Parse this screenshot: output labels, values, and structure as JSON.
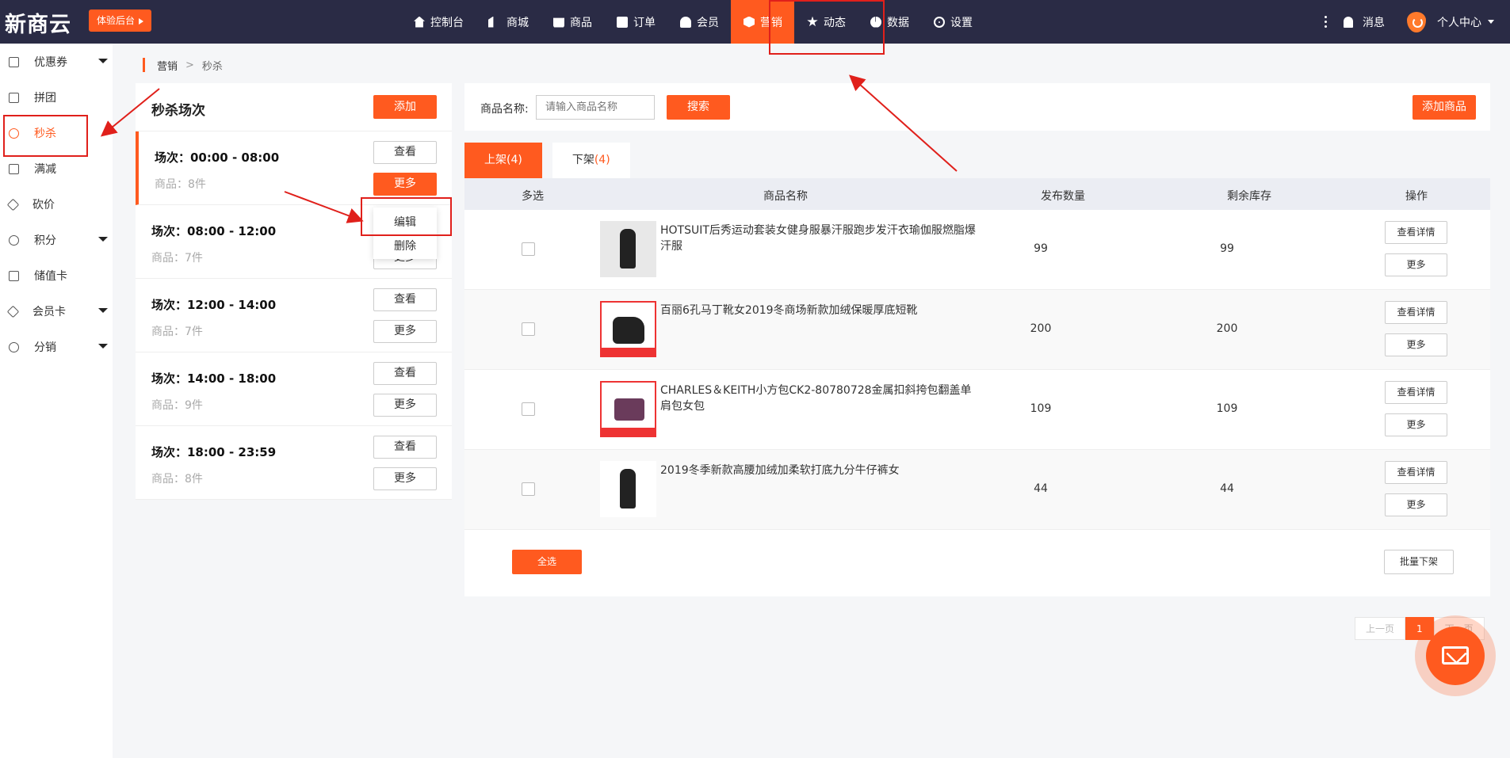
{
  "header": {
    "logo": "新商云",
    "trial_button": "体验后台",
    "nav": [
      {
        "label": "控制台",
        "icon": "home-icon"
      },
      {
        "label": "商城",
        "icon": "store-icon"
      },
      {
        "label": "商品",
        "icon": "bag-icon"
      },
      {
        "label": "订单",
        "icon": "document-icon"
      },
      {
        "label": "会员",
        "icon": "user-icon"
      },
      {
        "label": "营销",
        "icon": "box-icon",
        "active": true
      },
      {
        "label": "动态",
        "icon": "star-icon"
      },
      {
        "label": "数据",
        "icon": "pie-chart-icon"
      },
      {
        "label": "设置",
        "icon": "gear-icon"
      }
    ],
    "messages": "消息",
    "user_center": "个人中心"
  },
  "sidebar": {
    "items": [
      {
        "label": "优惠券",
        "has_dropdown": true
      },
      {
        "label": "拼团",
        "has_dropdown": false
      },
      {
        "label": "秒杀",
        "has_dropdown": false,
        "active": true
      },
      {
        "label": "满减",
        "has_dropdown": false
      },
      {
        "label": "砍价",
        "has_dropdown": false
      },
      {
        "label": "积分",
        "has_dropdown": true
      },
      {
        "label": "储值卡",
        "has_dropdown": false
      },
      {
        "label": "会员卡",
        "has_dropdown": true
      },
      {
        "label": "分销",
        "has_dropdown": true
      }
    ]
  },
  "breadcrumb": {
    "root": "营销",
    "separator": ">",
    "current": "秒杀"
  },
  "sessions_panel": {
    "title": "秒杀场次",
    "add_button": "添加",
    "view_label": "查看",
    "more_label": "更多",
    "sessions": [
      {
        "title": "场次：00:00 - 08:00",
        "count": "商品：8件"
      },
      {
        "title": "场次：08:00 - 12:00",
        "count": "商品：7件"
      },
      {
        "title": "场次：12:00 - 14:00",
        "count": "商品：7件"
      },
      {
        "title": "场次：14:00 - 18:00",
        "count": "商品：9件"
      },
      {
        "title": "场次：18:00 - 23:59",
        "count": "商品：8件"
      }
    ],
    "dropdown": {
      "edit": "编辑",
      "delete": "删除"
    }
  },
  "search": {
    "label": "商品名称:",
    "placeholder": "请输入商品名称",
    "search_button": "搜索",
    "add_product_button": "添加商品"
  },
  "tabs": [
    {
      "label": "上架",
      "count": "(4)",
      "active": true
    },
    {
      "label": "下架",
      "count": "(4)",
      "active": false
    }
  ],
  "table": {
    "headers": [
      "多选",
      "商品名称",
      "发布数量",
      "剩余库存",
      "操作"
    ],
    "rows": [
      {
        "name": "HOTSUIT后秀运动套装女健身服暴汗服跑步发汗衣瑜伽服燃脂爆汗服",
        "published": "99",
        "stock": "99"
      },
      {
        "name": "百丽6孔马丁靴女2019冬商场新款加绒保暖厚底短靴",
        "published": "200",
        "stock": "200"
      },
      {
        "name": "CHARLES＆KEITH小方包CK2-80780728金属扣斜挎包翻盖单肩包女包",
        "published": "109",
        "stock": "109"
      },
      {
        "name": "2019冬季新款高腰加绒加柔软打底九分牛仔裤女",
        "published": "44",
        "stock": "44"
      }
    ],
    "view_detail": "查看详情",
    "more": "更多",
    "select_all": "全选",
    "batch_offline": "批量下架"
  },
  "pagination": {
    "prev": "上一页",
    "current": "1",
    "next": "下一页"
  },
  "colors": {
    "accent": "#ff5a1f",
    "topbar": "#2a2b45",
    "annotation": "#e0201b"
  }
}
